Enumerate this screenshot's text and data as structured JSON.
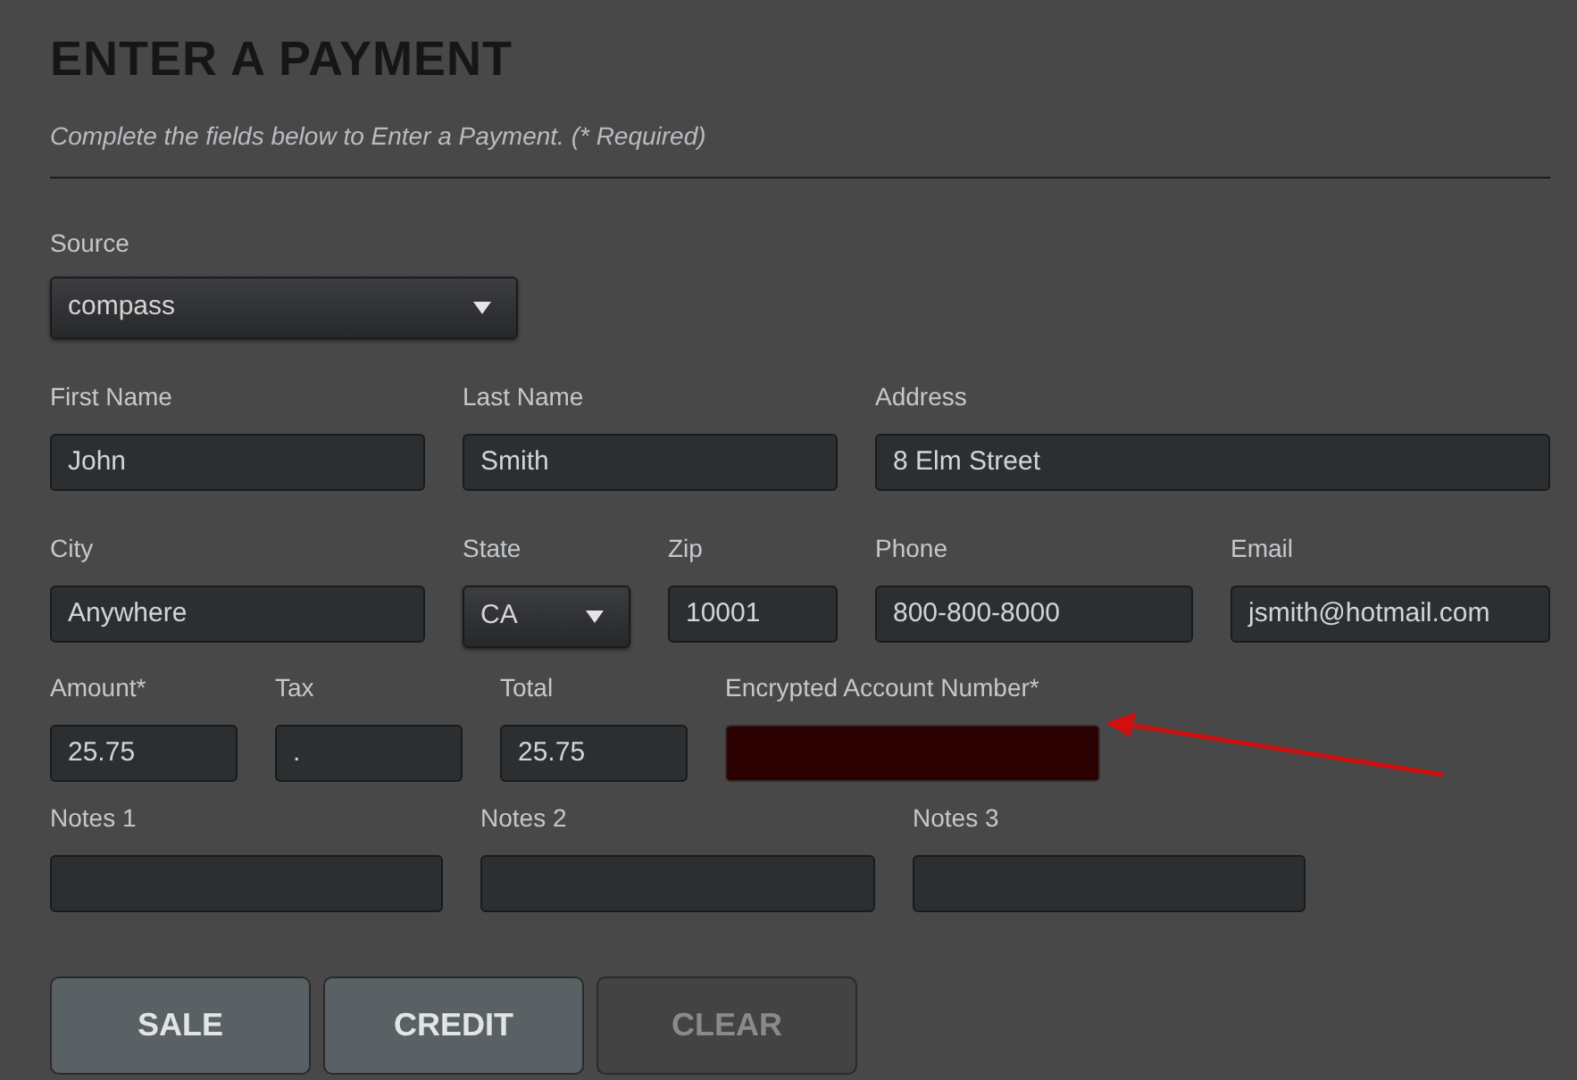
{
  "title": "ENTER A PAYMENT",
  "subtitle": "Complete the fields below to Enter a Payment. (* Required)",
  "source": {
    "label": "Source",
    "value": "compass",
    "kind": "select"
  },
  "rows": [
    [
      {
        "label": "First Name",
        "value": "John",
        "kind": "text"
      },
      {
        "label": "Last Name",
        "value": "Smith",
        "kind": "text"
      },
      {
        "label": "Address",
        "value": "8 Elm Street",
        "kind": "text"
      }
    ],
    [
      {
        "label": "City",
        "value": "Anywhere",
        "kind": "text"
      },
      {
        "label": "State",
        "value": "CA",
        "kind": "select"
      },
      {
        "label": "Zip",
        "value": "10001",
        "kind": "text"
      },
      {
        "label": "Phone",
        "value": "800-800-8000",
        "kind": "text"
      },
      {
        "label": "Email",
        "value": "jsmith@hotmail.com",
        "kind": "text"
      }
    ],
    [
      {
        "label": "Amount*",
        "value": "25.75",
        "kind": "text"
      },
      {
        "label": "Tax",
        "value": ".",
        "kind": "text"
      },
      {
        "label": "Total",
        "value": "25.75",
        "kind": "text"
      },
      {
        "label": "Encrypted Account Number*",
        "kind": "encrypted"
      }
    ],
    [
      {
        "label": "Notes 1",
        "kind": "text"
      },
      {
        "label": "Notes 2",
        "kind": "text"
      },
      {
        "label": "Notes 3",
        "kind": "text"
      }
    ]
  ],
  "buttons": [
    {
      "label": "SALE",
      "disabled": false
    },
    {
      "label": "CREDIT",
      "disabled": false
    },
    {
      "label": "CLEAR",
      "disabled": true
    }
  ]
}
